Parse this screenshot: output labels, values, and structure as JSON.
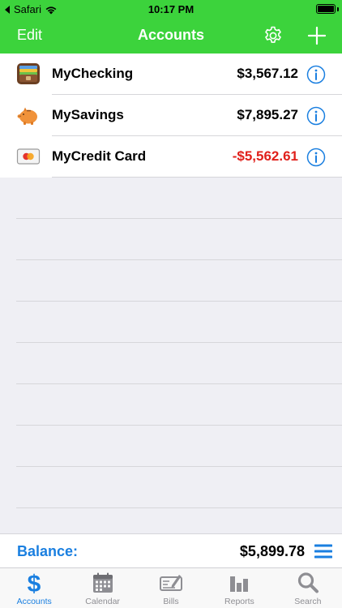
{
  "status_bar": {
    "back_app": "Safari",
    "time": "10:17 PM",
    "battery_level": 1.0
  },
  "nav": {
    "edit_label": "Edit",
    "title": "Accounts",
    "icons": [
      "gear-icon",
      "plus-icon"
    ]
  },
  "accounts": [
    {
      "name": "MyChecking",
      "amount": "$3,567.12",
      "negative": false,
      "icon": "wallet-icon"
    },
    {
      "name": "MySavings",
      "amount": "$7,895.27",
      "negative": false,
      "icon": "piggy-bank-icon"
    },
    {
      "name": "MyCredit Card",
      "amount": "-$5,562.61",
      "negative": true,
      "icon": "credit-card-icon"
    }
  ],
  "balance": {
    "label": "Balance:",
    "amount": "$5,899.78"
  },
  "tabs": [
    {
      "label": "Accounts",
      "icon": "dollar-icon",
      "active": true
    },
    {
      "label": "Calendar",
      "icon": "calendar-icon",
      "active": false
    },
    {
      "label": "Bills",
      "icon": "check-icon",
      "active": false
    },
    {
      "label": "Reports",
      "icon": "bar-chart-icon",
      "active": false
    },
    {
      "label": "Search",
      "icon": "search-icon",
      "active": false
    }
  ],
  "colors": {
    "accent_green": "#3cd33c",
    "link_blue": "#1a7fe0",
    "negative_red": "#e0201b"
  }
}
